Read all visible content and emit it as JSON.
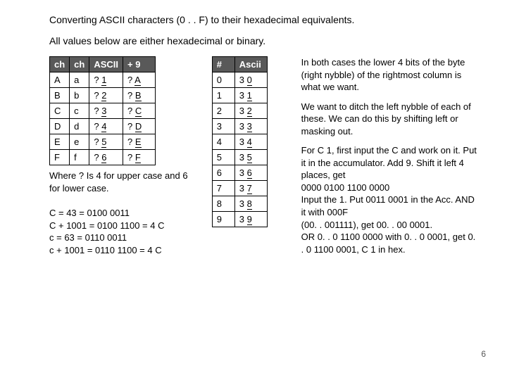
{
  "title": "Converting ASCII characters (0 . . F) to their hexadecimal equivalents.",
  "subtitle": "All values below are either hexadecimal or binary.",
  "left": {
    "table": {
      "headers": [
        "ch",
        "ch",
        "ASCII",
        "+ 9"
      ],
      "rows": [
        [
          "A",
          "a",
          "? 1",
          "? A"
        ],
        [
          "B",
          "b",
          "? 2",
          "? B"
        ],
        [
          "C",
          "c",
          "? 3",
          "? C"
        ],
        [
          "D",
          "d",
          "? 4",
          "? D"
        ],
        [
          "E",
          "e",
          "? 5",
          "? E"
        ],
        [
          "F",
          "f",
          "? 6",
          "? F"
        ]
      ]
    },
    "caption": "Where ? Is 4 for upper case and 6 for lower case.",
    "calc": [
      "C = 43 = 0100 0011",
      "C + 1001 = 0100 1100 = 4 C",
      "c  = 63 = 0110 0011",
      "c + 1001 = 0110 1100 = 4 C"
    ]
  },
  "mid": {
    "table": {
      "headers": [
        "#",
        "Ascii"
      ],
      "rows": [
        [
          "0",
          "3 0"
        ],
        [
          "1",
          "3 1"
        ],
        [
          "2",
          "3 2"
        ],
        [
          "3",
          "3 3"
        ],
        [
          "4",
          "3 4"
        ],
        [
          "5",
          "3 5"
        ],
        [
          "6",
          "3 6"
        ],
        [
          "7",
          "3 7"
        ],
        [
          "8",
          "3 8"
        ],
        [
          "9",
          "3 9"
        ]
      ]
    }
  },
  "right": {
    "p1": "In both cases the lower 4 bits of the byte (right nybble) of the rightmost column is what we want.",
    "p2": "We want to ditch the left nybble of each of these.  We can do this by shifting left or masking out.",
    "p3": "For C 1, first input the C  and work on it.  Put it in the accumulator.  Add 9.  Shift it left 4 places, get",
    "p4": "0000 0100 1100 0000",
    "p5": "Input the 1. Put 0011 0001 in the Acc.  AND it with 000F",
    "p6": "(00. . 001111), get 00. . 00 0001.",
    "p7": "OR 0. . 0 1100 0000 with 0. . 0 0001, get 0. . 0 1100 0001, C 1 in hex."
  },
  "pageNumber": "6"
}
